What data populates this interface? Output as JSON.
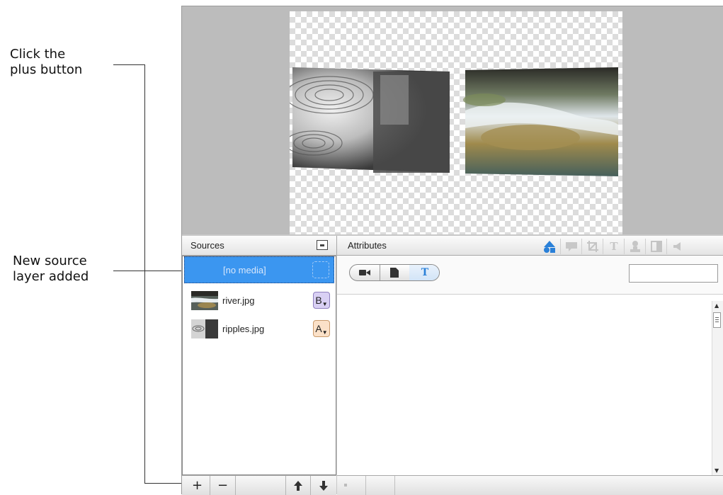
{
  "callouts": {
    "plus_line1": "Click the",
    "plus_line2": "plus button",
    "layer_line1": "New source",
    "layer_line2": "layer added"
  },
  "sources_panel": {
    "title": "Sources",
    "layers": [
      {
        "name": "[no media]",
        "badge": "",
        "selected": true
      },
      {
        "name": "river.jpg",
        "badge": "B",
        "badge_color": "#d9d0f4"
      },
      {
        "name": "ripples.jpg",
        "badge": "A",
        "badge_color": "#fbe1c8"
      }
    ],
    "buttons": {
      "add": "+",
      "remove": "−",
      "up": "▲",
      "down": "▼"
    }
  },
  "attributes_panel": {
    "title": "Attributes",
    "tabs": [
      "shapes-icon",
      "comment-icon",
      "crop-icon",
      "text-icon",
      "person-icon",
      "split-icon",
      "audio-icon"
    ],
    "active_tab": "shapes-icon",
    "segments": [
      "video-icon",
      "document-icon",
      "T"
    ],
    "active_segment": "T",
    "search_value": ""
  },
  "colors": {
    "selection": "#3b96f0",
    "active_blue": "#2a80d8",
    "preview_bg": "#bcbcbc"
  }
}
